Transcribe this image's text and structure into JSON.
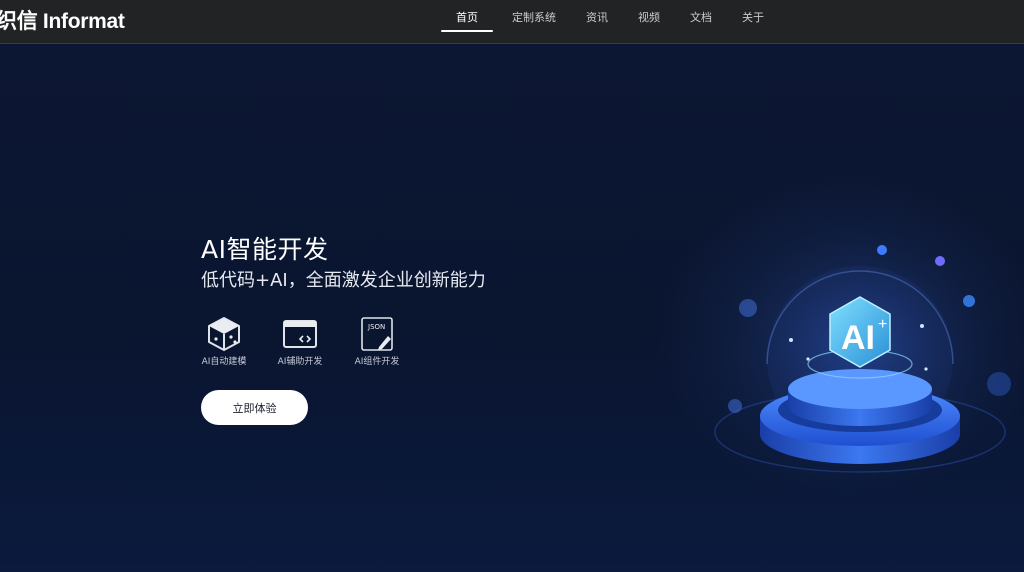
{
  "header": {
    "logo_text": "织信 Informat",
    "nav": [
      {
        "label": "首页",
        "active": true
      },
      {
        "label": "定制系统",
        "active": false
      },
      {
        "label": "资讯",
        "active": false
      },
      {
        "label": "视频",
        "active": false
      },
      {
        "label": "文档",
        "active": false
      },
      {
        "label": "关于",
        "active": false
      }
    ]
  },
  "hero": {
    "title": "AI智能开发",
    "subtitle": "低代码+AI，全面激发企业创新能力",
    "features": [
      {
        "label": "AI自动建模",
        "icon": "cube-icon"
      },
      {
        "label": "AI辅助开发",
        "icon": "code-window-icon"
      },
      {
        "label": "AI组件开发",
        "icon": "json-edit-icon",
        "icon_text": "JSON"
      }
    ],
    "cta_label": "立即体验",
    "illustration": {
      "badge_text": "AI",
      "badge_sup": "+"
    }
  },
  "colors": {
    "topbar": "#222325",
    "hero_bg": "#0b1630",
    "accent_blue": "#2f6ff0",
    "badge_teal": "#3fb6e6"
  }
}
